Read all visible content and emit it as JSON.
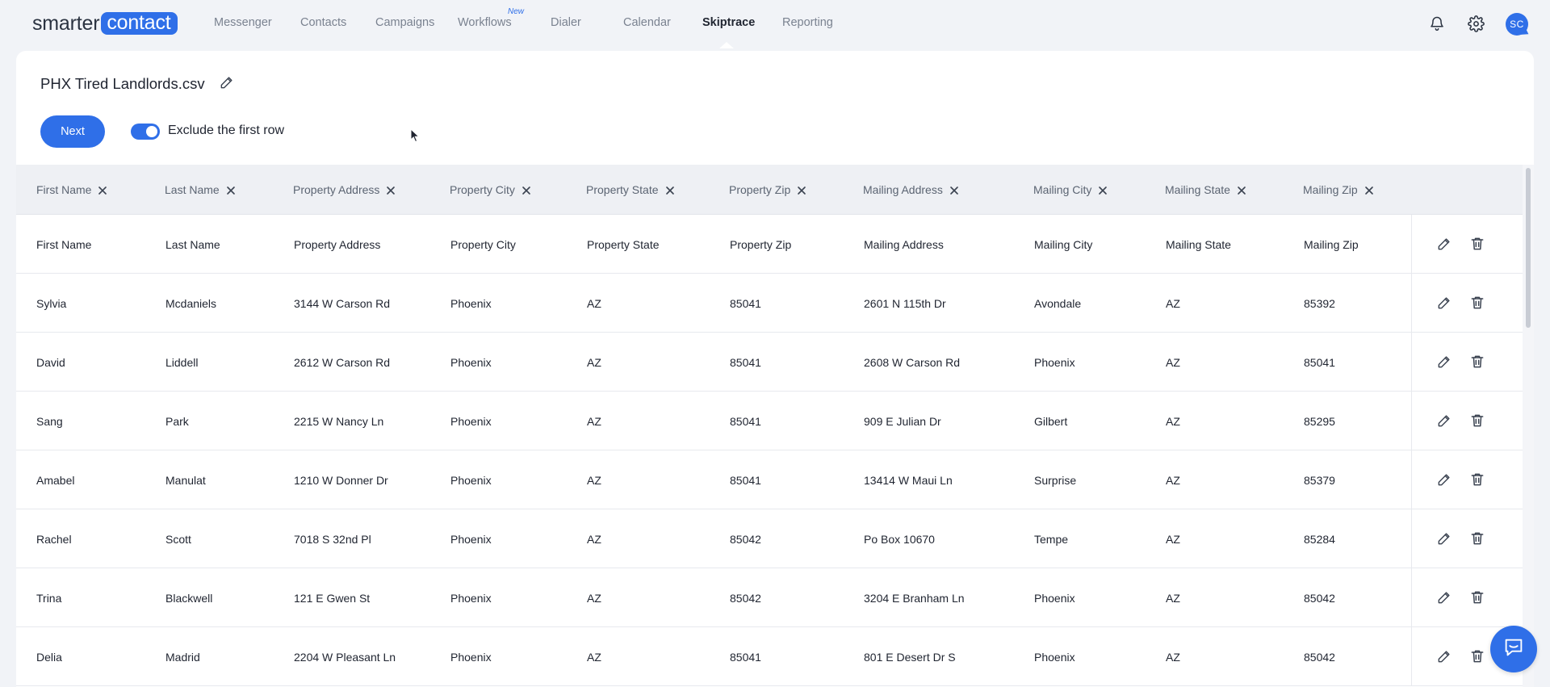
{
  "brand": {
    "part1": "smarter",
    "part2": "contact"
  },
  "nav": {
    "items": [
      {
        "label": "Messenger"
      },
      {
        "label": "Contacts"
      },
      {
        "label": "Campaigns"
      },
      {
        "label": "Workflows",
        "badge": "New"
      },
      {
        "label": "Dialer"
      },
      {
        "label": "Calendar"
      },
      {
        "label": "Skiptrace",
        "active": true
      },
      {
        "label": "Reporting"
      }
    ],
    "icons": [
      "bell-icon",
      "gear-icon"
    ],
    "avatar_initials": "SC"
  },
  "page": {
    "file_title": "PHX Tired Landlords.csv",
    "next_label": "Next",
    "toggle_label": "Exclude the first row",
    "toggle_on": true
  },
  "table": {
    "columns": [
      "First Name",
      "Last Name",
      "Property Address",
      "Property City",
      "Property State",
      "Property Zip",
      "Mailing Address",
      "Mailing City",
      "Mailing State",
      "Mailing Zip"
    ],
    "rows": [
      [
        "First Name",
        "Last Name",
        "Property Address",
        "Property City",
        "Property State",
        "Property Zip",
        "Mailing Address",
        "Mailing City",
        "Mailing State",
        "Mailing Zip"
      ],
      [
        "Sylvia",
        "Mcdaniels",
        "3144 W Carson Rd",
        "Phoenix",
        "AZ",
        "85041",
        "2601 N 115th Dr",
        "Avondale",
        "AZ",
        "85392"
      ],
      [
        "David",
        "Liddell",
        "2612 W Carson Rd",
        "Phoenix",
        "AZ",
        "85041",
        "2608 W Carson Rd",
        "Phoenix",
        "AZ",
        "85041"
      ],
      [
        "Sang",
        "Park",
        "2215 W Nancy Ln",
        "Phoenix",
        "AZ",
        "85041",
        "909 E Julian Dr",
        "Gilbert",
        "AZ",
        "85295"
      ],
      [
        "Amabel",
        "Manulat",
        "1210 W Donner Dr",
        "Phoenix",
        "AZ",
        "85041",
        "13414 W Maui Ln",
        "Surprise",
        "AZ",
        "85379"
      ],
      [
        "Rachel",
        "Scott",
        "7018 S 32nd Pl",
        "Phoenix",
        "AZ",
        "85042",
        "Po Box 10670",
        "Tempe",
        "AZ",
        "85284"
      ],
      [
        "Trina",
        "Blackwell",
        "121 E Gwen St",
        "Phoenix",
        "AZ",
        "85042",
        "3204 E Branham Ln",
        "Phoenix",
        "AZ",
        "85042"
      ],
      [
        "Delia",
        "Madrid",
        "2204 W Pleasant Ln",
        "Phoenix",
        "AZ",
        "85041",
        "801 E Desert Dr S",
        "Phoenix",
        "AZ",
        "85042"
      ]
    ]
  },
  "colors": {
    "accent": "#2f6fe8",
    "background": "#f1f3f7",
    "header_row": "#eef0f4"
  }
}
